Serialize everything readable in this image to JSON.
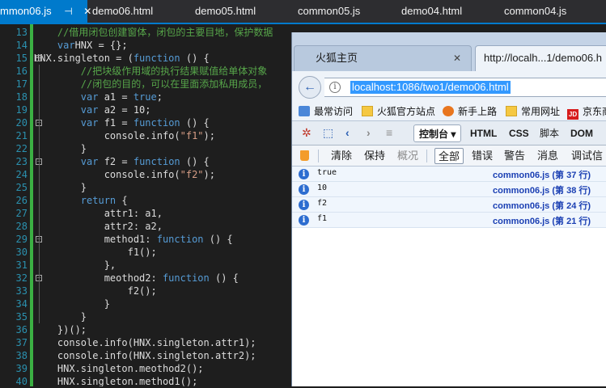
{
  "editor": {
    "tabs": [
      {
        "label": "mmon06.js",
        "active": true,
        "pin_icon": "⊣",
        "close_icon": "✕"
      },
      {
        "label": "demo06.html"
      },
      {
        "label": "demo05.html"
      },
      {
        "label": "common05.js"
      },
      {
        "label": "demo04.html"
      },
      {
        "label": "common04.js"
      }
    ],
    "line_numbers": [
      "13",
      "14",
      "15",
      "16",
      "17",
      "18",
      "19",
      "20",
      "21",
      "22",
      "23",
      "24",
      "25",
      "26",
      "27",
      "28",
      "29",
      "30",
      "31",
      "32",
      "33",
      "34",
      "35",
      "36",
      "37",
      "38",
      "39",
      "40"
    ],
    "code": [
      [
        [
          "cm",
          "    //借用闭包创建窗体，闭包的主要目地，保护数据"
        ]
      ],
      [
        [
          "kw",
          "    var"
        ],
        [
          "",
          "HNX = {};"
        ]
      ],
      [
        [
          "",
          "HNX.singleton = ("
        ],
        [
          "kw",
          "function"
        ],
        [
          "",
          " () {"
        ]
      ],
      [
        [
          "cm",
          "        //把块级作用域的执行结果赋值给单体对象"
        ]
      ],
      [
        [
          "cm",
          "        //闭包的目的，可以在里面添加私用成员，"
        ]
      ],
      [
        [
          "kw",
          "        var"
        ],
        [
          "",
          " a1 = "
        ],
        [
          "kw",
          "true"
        ],
        [
          "",
          ";"
        ]
      ],
      [
        [
          "kw",
          "        var"
        ],
        [
          "",
          " a2 = 10;"
        ]
      ],
      [
        [
          "kw",
          "        var"
        ],
        [
          "",
          " f1 = "
        ],
        [
          "kw",
          "function"
        ],
        [
          "",
          " () {"
        ]
      ],
      [
        [
          "",
          "            console.info("
        ],
        [
          "st",
          "\"f1\""
        ],
        [
          "",
          ");"
        ]
      ],
      [
        [
          "",
          "        }"
        ]
      ],
      [
        [
          "kw",
          "        var"
        ],
        [
          "",
          " f2 = "
        ],
        [
          "kw",
          "function"
        ],
        [
          "",
          " () {"
        ]
      ],
      [
        [
          "",
          "            console.info("
        ],
        [
          "st",
          "\"f2\""
        ],
        [
          "",
          ");"
        ]
      ],
      [
        [
          "",
          "        }"
        ]
      ],
      [
        [
          "kw",
          "        return"
        ],
        [
          "",
          " {"
        ]
      ],
      [
        [
          "",
          "            attr1: a1,"
        ]
      ],
      [
        [
          "",
          "            attr2: a2,"
        ]
      ],
      [
        [
          "",
          "            method1: "
        ],
        [
          "kw",
          "function"
        ],
        [
          "",
          " () {"
        ]
      ],
      [
        [
          "",
          "                f1();"
        ]
      ],
      [
        [
          "",
          "            },"
        ]
      ],
      [
        [
          "",
          "            meothod2: "
        ],
        [
          "kw",
          "function"
        ],
        [
          "",
          " () {"
        ]
      ],
      [
        [
          "",
          "                f2();"
        ]
      ],
      [
        [
          "",
          "            }"
        ]
      ],
      [
        [
          "",
          "        }"
        ]
      ],
      [
        [
          "",
          "    })();"
        ]
      ],
      [
        [
          "",
          "    console.info(HNX.singleton.attr1);"
        ]
      ],
      [
        [
          "",
          "    console.info(HNX.singleton.attr2);"
        ]
      ],
      [
        [
          "",
          "    HNX.singleton.meothod2();"
        ]
      ],
      [
        [
          "",
          "    HNX.singleton.method1();"
        ]
      ]
    ]
  },
  "browser": {
    "tabs": [
      {
        "label": "火狐主页",
        "close_icon": "✕"
      },
      {
        "label": "http://localh...1/demo06.h"
      }
    ],
    "url": "localhost:1086/two1/demo06.html",
    "bookmarks": [
      "最常访问",
      "火狐官方站点",
      "新手上路",
      "常用网址",
      "京东商"
    ],
    "devtools_tabs": [
      "控制台 ▾",
      "HTML",
      "CSS",
      "脚本",
      "DOM"
    ],
    "filter_buttons": [
      "清除",
      "保持",
      "概况",
      "全部",
      "错误",
      "警告",
      "消息",
      "调试信"
    ],
    "console_rows": [
      {
        "message": "true",
        "source": "common06.js (第 37 行)"
      },
      {
        "message": "10",
        "source": "common06.js (第 38 行)"
      },
      {
        "message": "f2",
        "source": "common06.js (第 24 行)"
      },
      {
        "message": "f1",
        "source": "common06.js (第 21 行)"
      }
    ],
    "colors": {
      "accent": "#007acc",
      "link": "#1a3fb3",
      "info": "#2d6dd0"
    }
  }
}
